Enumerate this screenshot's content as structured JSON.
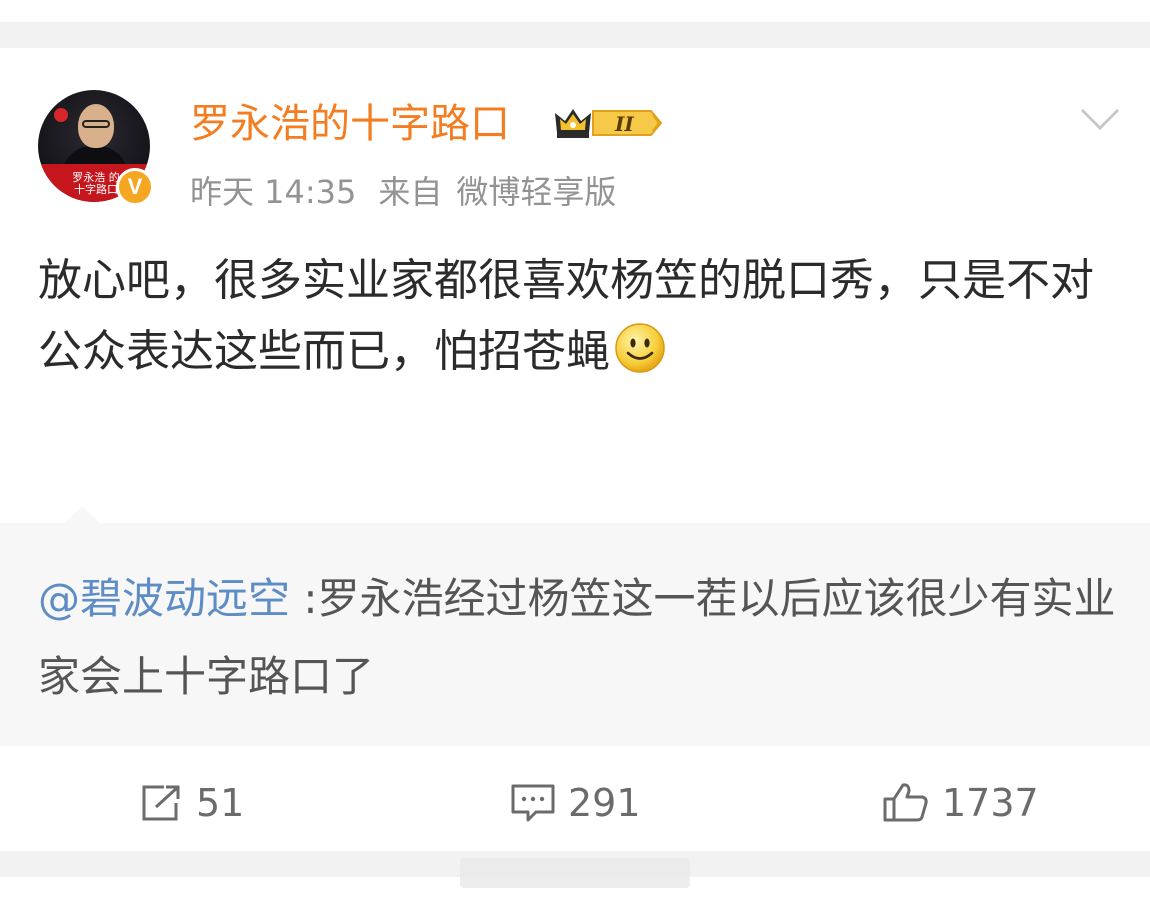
{
  "post": {
    "author": {
      "name": "罗永浩的十字路口",
      "avatar_caption": "罗永浩 的十字路口",
      "verified_mark": "V",
      "vip_level": "II",
      "brand_color": "#f37d20"
    },
    "meta": {
      "time": "昨天 14:35",
      "source_prefix": "来自",
      "source": "微博轻享版"
    },
    "text": "放心吧，很多实业家都很喜欢杨笠的脱口秀，只是不对公众表达这些而已，怕招苍蝇",
    "emoji": "smile-icon",
    "repost": {
      "mention": "@碧波动远空",
      "text": " :罗永浩经过杨笠这一茬以后应该很少有实业家会上十字路口了",
      "mention_color": "#5e8cc4"
    },
    "actions": {
      "share_count": "51",
      "comment_count": "291",
      "like_count": "1737"
    }
  },
  "icons": [
    "chevron-down-icon",
    "share-icon",
    "comment-icon",
    "like-icon",
    "crown-icon"
  ]
}
